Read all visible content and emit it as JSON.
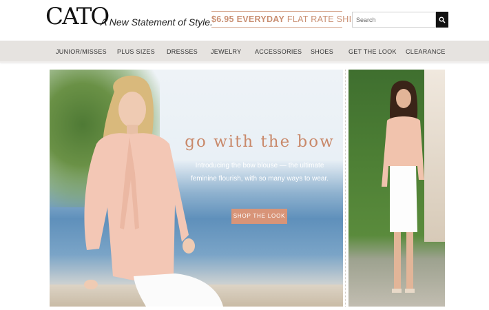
{
  "brand": {
    "logo": "CATO",
    "tagline": "A New Statement of Style."
  },
  "promo": {
    "price": "$6.95",
    "emphasis": "EVERYDAY",
    "rest": "FLAT RATE SHIPPING"
  },
  "search": {
    "placeholder": "Search",
    "icon": "search-icon"
  },
  "nav": {
    "items": [
      {
        "label": "JUNIOR/MISSES"
      },
      {
        "label": "PLUS SIZES"
      },
      {
        "label": "DRESSES"
      },
      {
        "label": "JEWELRY"
      },
      {
        "label": "ACCESSORIES"
      },
      {
        "label": "SHOES"
      },
      {
        "label": "GET THE LOOK"
      },
      {
        "label": "CLEARANCE"
      }
    ]
  },
  "hero": {
    "title": "go with the bow",
    "subtitle_line1": "Introducing the bow blouse — the ultimate",
    "subtitle_line2": "feminine flourish, with so many ways to wear.",
    "cta": "SHOP THE LOOK"
  },
  "colors": {
    "accent": "#d89478",
    "title": "#c9896b",
    "nav_bg": "#e6e3e0",
    "promo": "#c98f72"
  }
}
